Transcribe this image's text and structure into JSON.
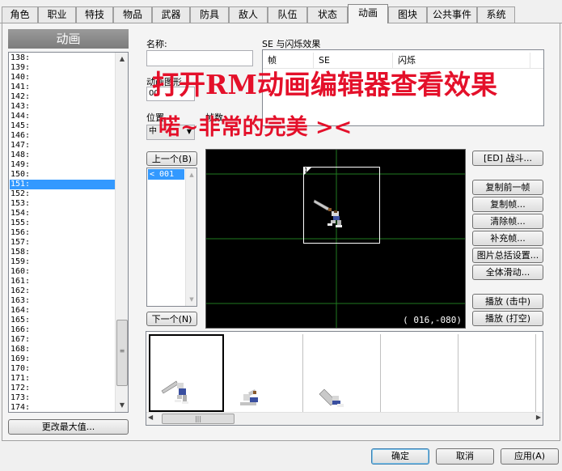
{
  "tabs": [
    "角色",
    "职业",
    "特技",
    "物品",
    "武器",
    "防具",
    "敌人",
    "队伍",
    "状态",
    "动画",
    "图块",
    "公共事件",
    "系统"
  ],
  "active_tab": "动画",
  "list": {
    "header": "动画",
    "items": [
      "138:",
      "139:",
      "140:",
      "141:",
      "142:",
      "143:",
      "144:",
      "145:",
      "146:",
      "147:",
      "148:",
      "149:",
      "150:",
      "151:",
      "152:",
      "153:",
      "154:",
      "155:",
      "156:",
      "157:",
      "158:",
      "159:",
      "160:",
      "161:",
      "162:",
      "163:",
      "164:",
      "165:",
      "166:",
      "167:",
      "168:",
      "169:",
      "170:",
      "171:",
      "172:",
      "173:",
      "174:"
    ],
    "selected": "151:",
    "change_max_button": "更改最大值..."
  },
  "form": {
    "name_label": "名称:",
    "name_value": "",
    "graphic_label": "动画图形",
    "graphic_value": "00",
    "position_label": "位置",
    "position_value": "中",
    "frames_label": "帧数:"
  },
  "se_table": {
    "title": "SE 与闪烁效果",
    "columns": [
      "帧",
      "SE",
      "闪烁"
    ]
  },
  "frame_nav": {
    "prev_button": "上一个(B)",
    "next_button": "下一个(N)",
    "frames": [
      "< 001"
    ]
  },
  "canvas": {
    "cell_number": "1",
    "coords": "( 016,-080)"
  },
  "side_buttons": [
    "[ED] 战斗...",
    "复制前一帧",
    "复制帧...",
    "清除帧...",
    "补充帧...",
    "图片总括设置...",
    "全体滑动...",
    "播放 (击中)",
    "播放 (打空)"
  ],
  "footer": {
    "ok": "确定",
    "cancel": "取消",
    "apply": "应用(A)"
  },
  "overlay": {
    "line1": "打开RM动画编辑器查看效果",
    "line2": "喏~非常的完美  ><"
  },
  "colors": {
    "selection": "#3399ff",
    "grid": "#1f7a1f",
    "overlay": "#e4102a"
  }
}
